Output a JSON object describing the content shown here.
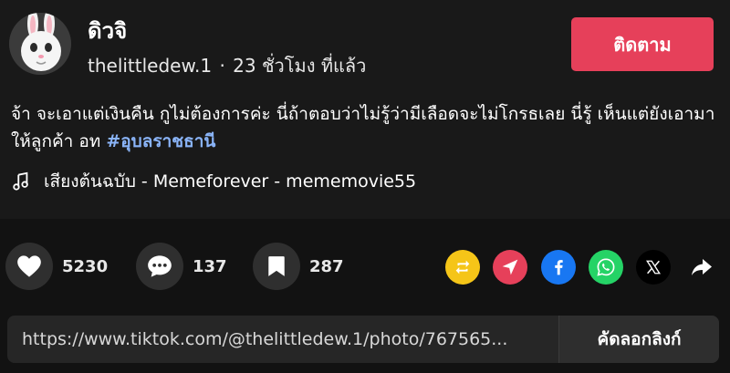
{
  "author": {
    "display_name": "ดิวจิ",
    "username": "thelittledew.1",
    "separator": "·",
    "posted_ago": "23 ชั่วโมง ที่แล้ว"
  },
  "follow_label": "ติดตาม",
  "caption": {
    "text": "จ้า จะเอาแต่เงินคืน กูไม่ต้องการค่ะ นี่ถ้าตอบว่าไม่รู้ว่ามีเลือดจะไม่โกรธเลย นี่รู้ เห็นแต่ยังเอามาให้ลูกค้า อท ",
    "hashtag": "#อุบลราชธานี"
  },
  "music": {
    "icon": "music-note-icon",
    "text": "เสียงต้นฉบับ - Memeforever - mememovie55"
  },
  "actions": {
    "likes": "5230",
    "comments": "137",
    "saves": "287"
  },
  "share": {
    "icons": [
      "repost-icon",
      "send-icon",
      "facebook-icon",
      "whatsapp-icon",
      "x-icon",
      "share-arrow-icon"
    ],
    "colors": {
      "repost": "#f5c518",
      "send": "#e6405a",
      "facebook": "#1877f2",
      "whatsapp": "#25d366",
      "x": "#000000"
    }
  },
  "link": {
    "url": "https://www.tiktok.com/@thelittledew.1/photo/767565...",
    "copy_label": "คัดลอกลิงก์"
  },
  "colors": {
    "accent": "#e6405a",
    "hashtag": "#8ab4f8"
  }
}
